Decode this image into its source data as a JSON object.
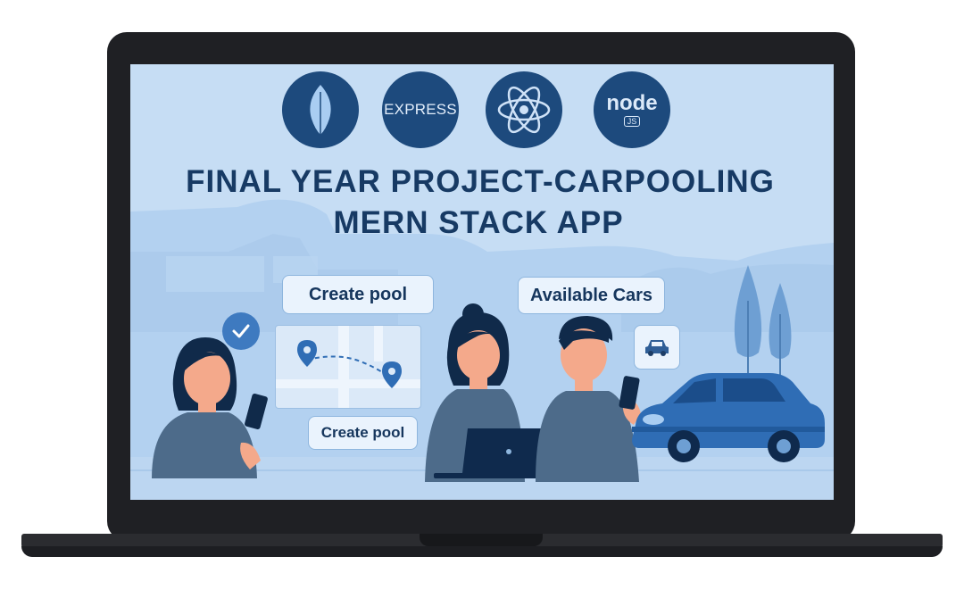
{
  "logos": {
    "mongodb_icon": "leaf-icon",
    "express_label": "EXPRESS",
    "react_icon": "atom-icon",
    "node_label": "node",
    "node_badge": "JS"
  },
  "title": {
    "line1": "FINAL YEAR PROJECT-CARPOOLING",
    "line2": "MERN STACK APP"
  },
  "chips": {
    "create_pool_top": "Create pool",
    "available_cars": "Available Cars",
    "create_pool_bottom": "Create pool"
  },
  "colors": {
    "screen_bg": "#c6ddf4",
    "logo_circle": "#1d4a7d",
    "title_text": "#173a64",
    "car_body": "#2f6db5",
    "people_shirt": "#4d6b8a"
  }
}
